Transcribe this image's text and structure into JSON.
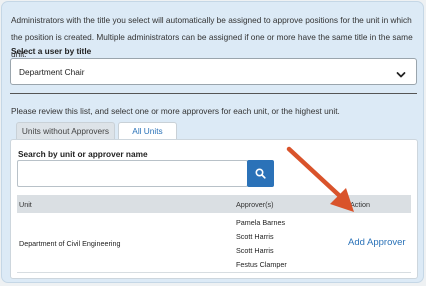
{
  "intro_text": "Administrators with the title you select will automatically be assigned to approve positions for the unit in which the position is created. Multiple administrators can be assigned if one or more have the same title in the same unit.",
  "select": {
    "label": "Select a user by title",
    "value": "Department Chair",
    "icon": "chevron-down-icon"
  },
  "review_text": "Please review this list, and select one or more approvers for each unit, or the highest unit.",
  "tabs": [
    {
      "label": "Units without Approvers",
      "active": false
    },
    {
      "label": "All Units",
      "active": true
    }
  ],
  "search": {
    "label": "Search by unit or approver name",
    "value": "",
    "button_icon": "search-icon"
  },
  "table": {
    "headers": [
      "Unit",
      "Approver(s)",
      "Action"
    ],
    "rows": [
      {
        "unit": "Department of Civil Engineering",
        "approvers": [
          "Pamela Barnes",
          "Scott Harris",
          "Scott Harris",
          "Festus Clamper"
        ],
        "action": "Add Approver"
      }
    ]
  },
  "colors": {
    "accent": "#2b72b8",
    "panel_bg": "#dceaf6",
    "arrow": "#d9532b"
  }
}
